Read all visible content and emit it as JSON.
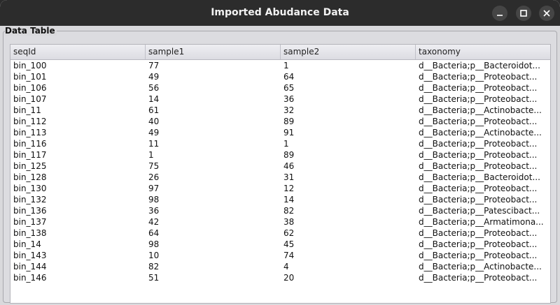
{
  "window": {
    "title": "Imported Abudance Data"
  },
  "group": {
    "title": "Data Table"
  },
  "table": {
    "columns": [
      "seqId",
      "sample1",
      "sample2",
      "taxonomy"
    ],
    "rows": [
      [
        "bin_100",
        "77",
        "1",
        "d__Bacteria;p__Bacteroidot..."
      ],
      [
        "bin_101",
        "49",
        "64",
        "d__Bacteria;p__Proteobact..."
      ],
      [
        "bin_106",
        "56",
        "65",
        "d__Bacteria;p__Proteobact..."
      ],
      [
        "bin_107",
        "14",
        "36",
        "d__Bacteria;p__Proteobact..."
      ],
      [
        "bin_11",
        "61",
        "32",
        "d__Bacteria;p__Actinobacte..."
      ],
      [
        "bin_112",
        "40",
        "89",
        "d__Bacteria;p__Proteobact..."
      ],
      [
        "bin_113",
        "49",
        "91",
        "d__Bacteria;p__Actinobacte..."
      ],
      [
        "bin_116",
        "11",
        "1",
        "d__Bacteria;p__Proteobact..."
      ],
      [
        "bin_117",
        "1",
        "89",
        "d__Bacteria;p__Proteobact..."
      ],
      [
        "bin_125",
        "75",
        "46",
        "d__Bacteria;p__Proteobact..."
      ],
      [
        "bin_128",
        "26",
        "31",
        "d__Bacteria;p__Bacteroidot..."
      ],
      [
        "bin_130",
        "97",
        "12",
        "d__Bacteria;p__Proteobact..."
      ],
      [
        "bin_132",
        "98",
        "14",
        "d__Bacteria;p__Proteobact..."
      ],
      [
        "bin_136",
        "36",
        "82",
        "d__Bacteria;p__Patescibact..."
      ],
      [
        "bin_137",
        "42",
        "38",
        "d__Bacteria;p__Armatimona..."
      ],
      [
        "bin_138",
        "64",
        "62",
        "d__Bacteria;p__Proteobact..."
      ],
      [
        "bin_14",
        "98",
        "45",
        "d__Bacteria;p__Proteobact..."
      ],
      [
        "bin_143",
        "10",
        "74",
        "d__Bacteria;p__Proteobact..."
      ],
      [
        "bin_144",
        "82",
        "4",
        "d__Bacteria;p__Actinobacte..."
      ],
      [
        "bin_146",
        "51",
        "20",
        "d__Bacteria;p__Proteobact..."
      ]
    ]
  },
  "icons": {
    "minimize": "minimize-icon",
    "maximize": "maximize-icon",
    "close": "close-icon"
  },
  "colors": {
    "titlebar": "#2c2c2c",
    "window_bg": "#d9d9dc",
    "table_bg": "#ffffff"
  }
}
